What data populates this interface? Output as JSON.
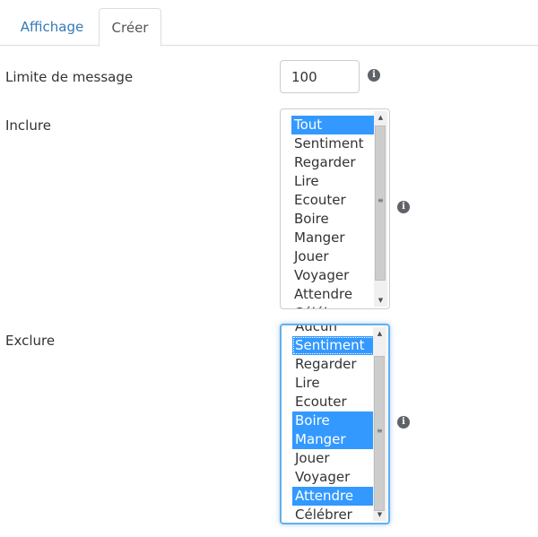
{
  "tabs": {
    "affichage": "Affichage",
    "creer": "Créer"
  },
  "message_limit": {
    "label": "Limite de message",
    "value": "100"
  },
  "include": {
    "label": "Inclure",
    "options": [
      "Tout",
      "Sentiment",
      "Regarder",
      "Lire",
      "Ecouter",
      "Boire",
      "Manger",
      "Jouer",
      "Voyager",
      "Attendre",
      "Célébrer"
    ],
    "selected": [
      "Tout"
    ]
  },
  "exclude": {
    "label": "Exclure",
    "options": [
      "Aucun",
      "Sentiment",
      "Regarder",
      "Lire",
      "Ecouter",
      "Boire",
      "Manger",
      "Jouer",
      "Voyager",
      "Attendre",
      "Célébrer"
    ],
    "selected": [
      "Sentiment",
      "Boire",
      "Manger",
      "Attendre"
    ]
  },
  "icons": {
    "info": "i",
    "arrow_up": "▲",
    "arrow_down": "▼",
    "grip": "≡"
  },
  "colors": {
    "accent": "#337ab7",
    "selection": "#3399ff",
    "focus_border": "#66afe9"
  }
}
